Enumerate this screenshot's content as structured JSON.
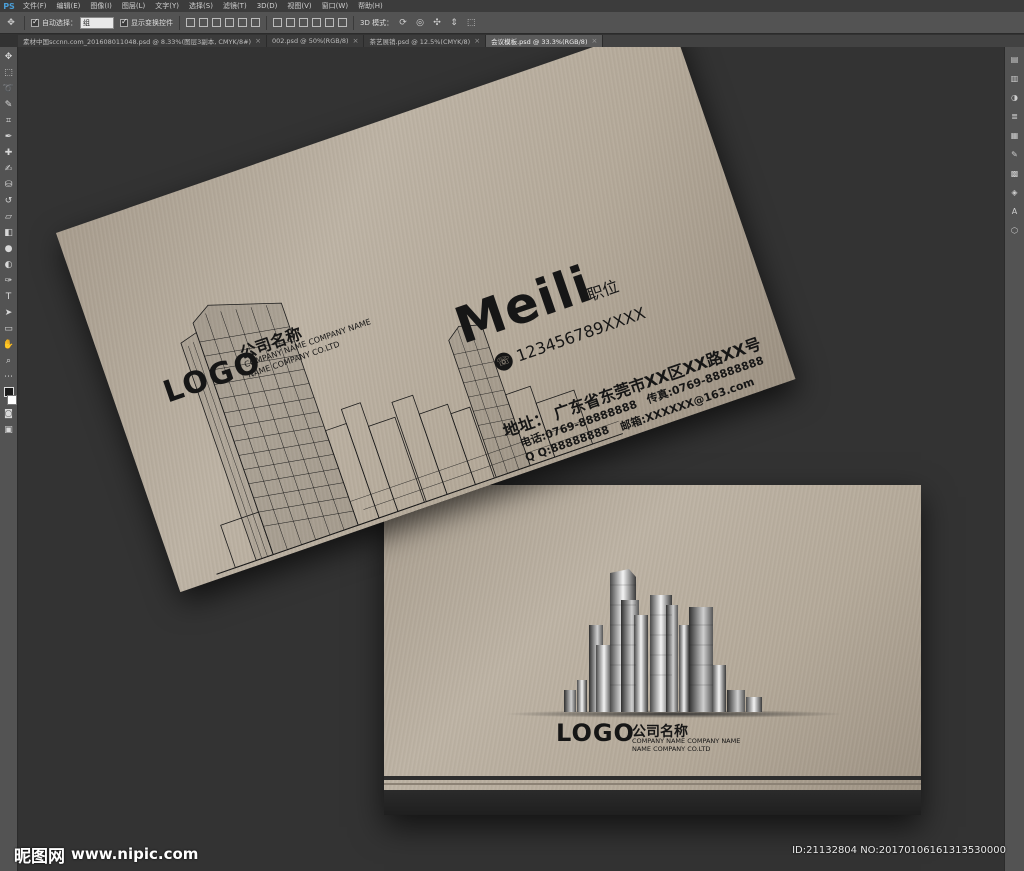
{
  "menubar": {
    "app_logo": "PS",
    "items": [
      "文件(F)",
      "编辑(E)",
      "图像(I)",
      "图层(L)",
      "文字(Y)",
      "选择(S)",
      "滤镜(T)",
      "3D(D)",
      "视图(V)",
      "窗口(W)",
      "帮助(H)"
    ]
  },
  "options": {
    "auto_select_label": "自动选择：",
    "auto_select_value": "组",
    "transform_label": "显示变换控件",
    "mode_label": "3D 模式："
  },
  "tabs": [
    {
      "label": "素材中国sccnn.com_201608011048.psd @ 8.33%(图层3副本, CMYK/8#)",
      "active": false
    },
    {
      "label": "002.psd @ 50%(RGB/8)",
      "active": false
    },
    {
      "label": "茶艺展销.psd @ 12.5%(CMYK/8)",
      "active": false
    },
    {
      "label": "会议模板.psd @ 33.3%(RGB/8)",
      "active": true
    }
  ],
  "front_card": {
    "logo": "LOGO",
    "company_cn": "公司名称",
    "company_en_1": "COMPANY NAME COMPANY NAME",
    "company_en_2": "NAME COMPANY CO.LTD",
    "name": "Meili",
    "position": "职位",
    "phone": "123456789XXXX",
    "address": "地址：  广东省东莞市XX区XX路XX号",
    "tel": "电话:0769-88888888",
    "fax": "传真:0769-88888888",
    "qq": "Q Q:88888888",
    "email": "邮箱:XXXXXX@163.com"
  },
  "back_card": {
    "logo": "LOGO",
    "company_cn": "公司名称",
    "company_en_1": "COMPANY NAME COMPANY NAME",
    "company_en_2": "NAME COMPANY CO.LTD"
  },
  "watermark": {
    "site_cn": "昵图网",
    "site_url": "www.nipic.com",
    "id_text": "ID:21132804 NO:20170106161313530000"
  },
  "colors": {
    "card_base": "#b3a898",
    "ink": "#161616",
    "workspace": "#333333"
  }
}
